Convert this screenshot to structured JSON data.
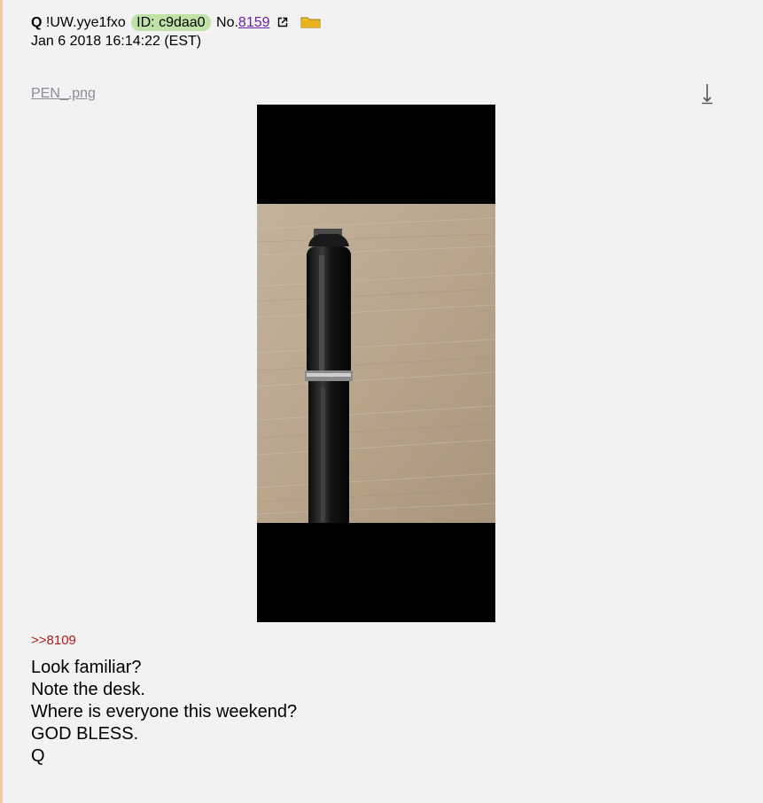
{
  "post": {
    "name": "Q",
    "tripcode": "!UW.yye1fxo",
    "id_label": "ID: c9daa0",
    "number_prefix": "No.",
    "number": "8159",
    "date": "Jan 6 2018 16:14:22 (EST)",
    "icons": {
      "external": "external-link-icon",
      "folder": "folder-icon",
      "download": "download-arrow-icon"
    },
    "file": {
      "name": "PEN_.png"
    },
    "quote": ">>8109",
    "body": [
      "Look familiar?",
      "Note the desk.",
      "Where is everyone this weekend?",
      "GOD BLESS.",
      "Q"
    ]
  },
  "colors": {
    "background": "#f2f2f2",
    "left_bar": "#f0c9a0",
    "id_badge": "#bfe3a6",
    "post_link": "#6b21a8",
    "quote_link": "#b11c1c",
    "filename": "#8d8d99"
  }
}
